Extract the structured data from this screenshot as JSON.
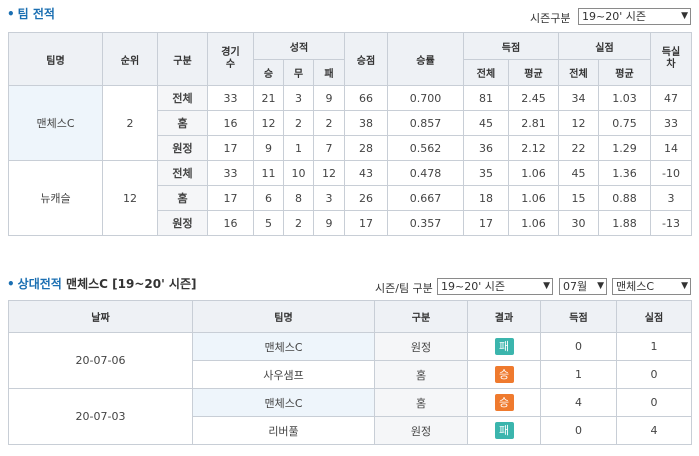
{
  "team_record": {
    "title": "팀 전적",
    "season_label": "시즌구분",
    "season_value": "19~20' 시즌",
    "headers": {
      "team": "팀명",
      "rank": "순위",
      "type": "구분",
      "games": "경기수",
      "result": "성적",
      "win": "승",
      "draw": "무",
      "loss": "패",
      "points": "승점",
      "win_rate": "승률",
      "scored": "득점",
      "conceded": "실점",
      "total": "전체",
      "avg": "평균",
      "diff": "득실차"
    },
    "teams": [
      {
        "name": "맨체스C",
        "rank": "2",
        "rows": [
          {
            "type": "전체",
            "games": "33",
            "w": "21",
            "d": "3",
            "l": "9",
            "pts": "66",
            "rate": "0.700",
            "gf": "81",
            "gfa": "2.45",
            "ga": "34",
            "gaa": "1.03",
            "diff": "47"
          },
          {
            "type": "홈",
            "games": "16",
            "w": "12",
            "d": "2",
            "l": "2",
            "pts": "38",
            "rate": "0.857",
            "gf": "45",
            "gfa": "2.81",
            "ga": "12",
            "gaa": "0.75",
            "diff": "33"
          },
          {
            "type": "원정",
            "games": "17",
            "w": "9",
            "d": "1",
            "l": "7",
            "pts": "28",
            "rate": "0.562",
            "gf": "36",
            "gfa": "2.12",
            "ga": "22",
            "gaa": "1.29",
            "diff": "14"
          }
        ]
      },
      {
        "name": "뉴캐슬",
        "rank": "12",
        "rows": [
          {
            "type": "전체",
            "games": "33",
            "w": "11",
            "d": "10",
            "l": "12",
            "pts": "43",
            "rate": "0.478",
            "gf": "35",
            "gfa": "1.06",
            "ga": "45",
            "gaa": "1.36",
            "diff": "-10"
          },
          {
            "type": "홈",
            "games": "17",
            "w": "6",
            "d": "8",
            "l": "3",
            "pts": "26",
            "rate": "0.667",
            "gf": "18",
            "gfa": "1.06",
            "ga": "15",
            "gaa": "0.88",
            "diff": "3"
          },
          {
            "type": "원정",
            "games": "16",
            "w": "5",
            "d": "2",
            "l": "9",
            "pts": "17",
            "rate": "0.357",
            "gf": "17",
            "gfa": "1.06",
            "ga": "30",
            "gaa": "1.88",
            "diff": "-13"
          }
        ]
      }
    ]
  },
  "head_to_head": {
    "title": "상대전적",
    "subtitle": "맨체스C [19~20' 시즌]",
    "filter_label": "시즌/팀 구분",
    "season_value": "19~20' 시즌",
    "month_value": "07월",
    "team_value": "맨체스C",
    "headers": {
      "date": "날짜",
      "team": "팀명",
      "type": "구분",
      "result": "결과",
      "scored": "득점",
      "conceded": "실점"
    },
    "matches": [
      {
        "date": "20-07-06",
        "rows": [
          {
            "team": "맨체스C",
            "type": "원정",
            "result": "패",
            "gf": "0",
            "ga": "1"
          },
          {
            "team": "사우샘프",
            "type": "홈",
            "result": "승",
            "gf": "1",
            "ga": "0"
          }
        ]
      },
      {
        "date": "20-07-03",
        "rows": [
          {
            "team": "맨체스C",
            "type": "홈",
            "result": "승",
            "gf": "4",
            "ga": "0"
          },
          {
            "team": "리버풀",
            "type": "원정",
            "result": "패",
            "gf": "0",
            "ga": "4"
          }
        ]
      }
    ]
  },
  "colors": {
    "accent": "#1b6fb2",
    "win": "#ef7a2e",
    "loss": "#3bb5ad"
  },
  "icons": {
    "select_arrow": "▼"
  }
}
